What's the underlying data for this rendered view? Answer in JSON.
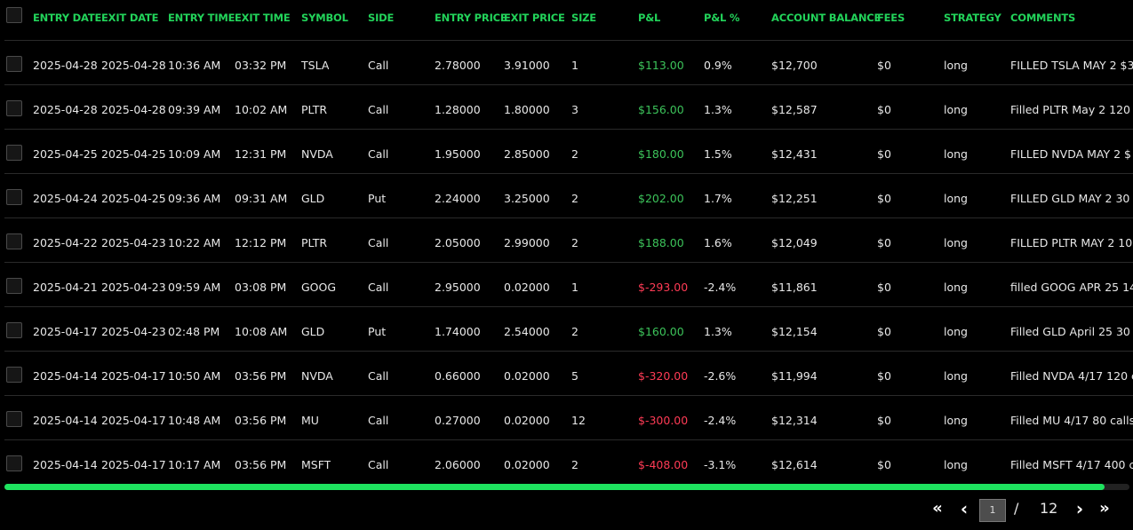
{
  "columns": {
    "entry_date": "ENTRY DATE",
    "exit_date": "EXIT DATE",
    "entry_time": "ENTRY TIME",
    "exit_time": "EXIT TIME",
    "symbol": "SYMBOL",
    "side": "SIDE",
    "entry_price": "ENTRY PRICE",
    "exit_price": "EXIT PRICE",
    "size": "SIZE",
    "pnl": "P&L",
    "pnl_pct": "P&L %",
    "account_balance": "ACCOUNT BALANCE",
    "fees": "FEES",
    "strategy": "STRATEGY",
    "comments": "COMMENTS"
  },
  "rows": [
    {
      "entry_date": "2025-04-28",
      "exit_date": "2025-04-28",
      "entry_time": "10:36 AM",
      "exit_time": "03:32 PM",
      "symbol": "TSLA",
      "side": "Call",
      "entry_price": "2.78000",
      "exit_price": "3.91000",
      "size": "1",
      "pnl": "$113.00",
      "pnl_sign": "pos",
      "pnl_pct": "0.9%",
      "account_balance": "$12,700",
      "fees": "$0",
      "strategy": "long",
      "comments": "FILLED TSLA MAY 2 $3"
    },
    {
      "entry_date": "2025-04-28",
      "exit_date": "2025-04-28",
      "entry_time": "09:39 AM",
      "exit_time": "10:02 AM",
      "symbol": "PLTR",
      "side": "Call",
      "entry_price": "1.28000",
      "exit_price": "1.80000",
      "size": "3",
      "pnl": "$156.00",
      "pnl_sign": "pos",
      "pnl_pct": "1.3%",
      "account_balance": "$12,587",
      "fees": "$0",
      "strategy": "long",
      "comments": "Filled PLTR May 2 120 c"
    },
    {
      "entry_date": "2025-04-25",
      "exit_date": "2025-04-25",
      "entry_time": "10:09 AM",
      "exit_time": "12:31 PM",
      "symbol": "NVDA",
      "side": "Call",
      "entry_price": "1.95000",
      "exit_price": "2.85000",
      "size": "2",
      "pnl": "$180.00",
      "pnl_sign": "pos",
      "pnl_pct": "1.5%",
      "account_balance": "$12,431",
      "fees": "$0",
      "strategy": "long",
      "comments": "FILLED NVDA MAY 2 $"
    },
    {
      "entry_date": "2025-04-24",
      "exit_date": "2025-04-25",
      "entry_time": "09:36 AM",
      "exit_time": "09:31 AM",
      "symbol": "GLD",
      "side": "Put",
      "entry_price": "2.24000",
      "exit_price": "3.25000",
      "size": "2",
      "pnl": "$202.00",
      "pnl_sign": "pos",
      "pnl_pct": "1.7%",
      "account_balance": "$12,251",
      "fees": "$0",
      "strategy": "long",
      "comments": "FILLED GLD MAY 2 30"
    },
    {
      "entry_date": "2025-04-22",
      "exit_date": "2025-04-23",
      "entry_time": "10:22 AM",
      "exit_time": "12:12 PM",
      "symbol": "PLTR",
      "side": "Call",
      "entry_price": "2.05000",
      "exit_price": "2.99000",
      "size": "2",
      "pnl": "$188.00",
      "pnl_sign": "pos",
      "pnl_pct": "1.6%",
      "account_balance": "$12,049",
      "fees": "$0",
      "strategy": "long",
      "comments": "FILLED PLTR MAY 2 10"
    },
    {
      "entry_date": "2025-04-21",
      "exit_date": "2025-04-23",
      "entry_time": "09:59 AM",
      "exit_time": "03:08 PM",
      "symbol": "GOOG",
      "side": "Call",
      "entry_price": "2.95000",
      "exit_price": "0.02000",
      "size": "1",
      "pnl": "$-293.00",
      "pnl_sign": "neg",
      "pnl_pct": "-2.4%",
      "account_balance": "$11,861",
      "fees": "$0",
      "strategy": "long",
      "comments": "filled GOOG APR 25 14"
    },
    {
      "entry_date": "2025-04-17",
      "exit_date": "2025-04-23",
      "entry_time": "02:48 PM",
      "exit_time": "10:08 AM",
      "symbol": "GLD",
      "side": "Put",
      "entry_price": "1.74000",
      "exit_price": "2.54000",
      "size": "2",
      "pnl": "$160.00",
      "pnl_sign": "pos",
      "pnl_pct": "1.3%",
      "account_balance": "$12,154",
      "fees": "$0",
      "strategy": "long",
      "comments": "Filled GLD April 25 30"
    },
    {
      "entry_date": "2025-04-14",
      "exit_date": "2025-04-17",
      "entry_time": "10:50 AM",
      "exit_time": "03:56 PM",
      "symbol": "NVDA",
      "side": "Call",
      "entry_price": "0.66000",
      "exit_price": "0.02000",
      "size": "5",
      "pnl": "$-320.00",
      "pnl_sign": "neg",
      "pnl_pct": "-2.6%",
      "account_balance": "$11,994",
      "fees": "$0",
      "strategy": "long",
      "comments": "Filled NVDA 4/17 120 c"
    },
    {
      "entry_date": "2025-04-14",
      "exit_date": "2025-04-17",
      "entry_time": "10:48 AM",
      "exit_time": "03:56 PM",
      "symbol": "MU",
      "side": "Call",
      "entry_price": "0.27000",
      "exit_price": "0.02000",
      "size": "12",
      "pnl": "$-300.00",
      "pnl_sign": "neg",
      "pnl_pct": "-2.4%",
      "account_balance": "$12,314",
      "fees": "$0",
      "strategy": "long",
      "comments": "Filled MU 4/17 80 calls"
    },
    {
      "entry_date": "2025-04-14",
      "exit_date": "2025-04-17",
      "entry_time": "10:17 AM",
      "exit_time": "03:56 PM",
      "symbol": "MSFT",
      "side": "Call",
      "entry_price": "2.06000",
      "exit_price": "0.02000",
      "size": "2",
      "pnl": "$-408.00",
      "pnl_sign": "neg",
      "pnl_pct": "-3.1%",
      "account_balance": "$12,614",
      "fees": "$0",
      "strategy": "long",
      "comments": "Filled MSFT 4/17 400 c"
    }
  ],
  "colors": {
    "accent": "#22d35a",
    "positive": "#3cc35a",
    "negative": "#ff3b55",
    "background": "#000000"
  },
  "scrollbar": {
    "thumb_fraction": 0.978
  },
  "pagination": {
    "first_icon": "double-chevron-left-icon",
    "prev_icon": "chevron-left-icon",
    "next_icon": "chevron-right-icon",
    "last_icon": "double-chevron-right-icon",
    "first_glyph": "«",
    "prev_glyph": "‹",
    "next_glyph": "›",
    "last_glyph": "»",
    "current_page": "1",
    "separator": "/",
    "total_pages": "12"
  }
}
